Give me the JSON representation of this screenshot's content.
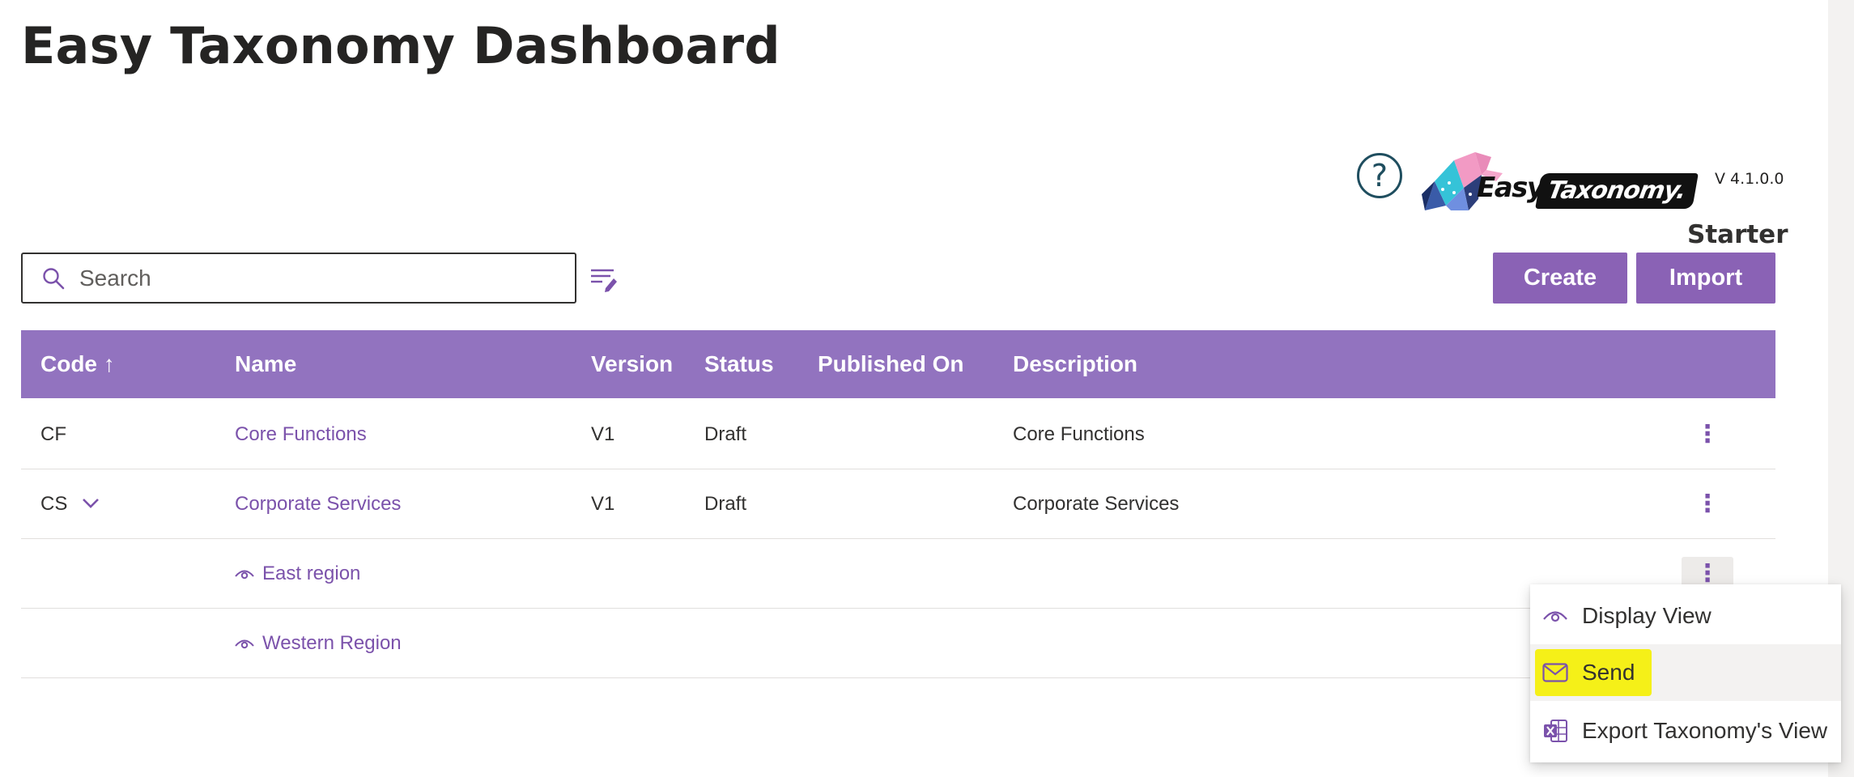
{
  "page": {
    "title": "Easy Taxonomy Dashboard"
  },
  "brand": {
    "logo_word_1": "Easy",
    "logo_word_2": "Taxonomy.",
    "version": "V 4.1.0.0",
    "plan": "Starter"
  },
  "toolbar": {
    "search_placeholder": "Search",
    "create_label": "Create",
    "import_label": "Import"
  },
  "table": {
    "columns": [
      "Code ↑",
      "Name",
      "Version",
      "Status",
      "Published On",
      "Description"
    ],
    "rows": [
      {
        "code": "CF",
        "name": "Core Functions",
        "version": "V1",
        "status": "Draft",
        "published": "",
        "description": "Core Functions"
      },
      {
        "code": "CS",
        "name": "Corporate Services",
        "version": "V1",
        "status": "Draft",
        "published": "",
        "description": "Corporate Services"
      }
    ],
    "views": [
      {
        "name": "East region"
      },
      {
        "name": "Western Region"
      }
    ]
  },
  "context_menu": {
    "items": [
      {
        "label": "Display View",
        "icon": "eye-icon"
      },
      {
        "label": "Send",
        "icon": "mail-icon"
      },
      {
        "label": "Export Taxonomy's View",
        "icon": "excel-icon"
      }
    ]
  },
  "colors": {
    "accent": "#8a62b5",
    "header": "#9273bf",
    "link": "#7b52ab",
    "highlight": "#f5f018"
  }
}
